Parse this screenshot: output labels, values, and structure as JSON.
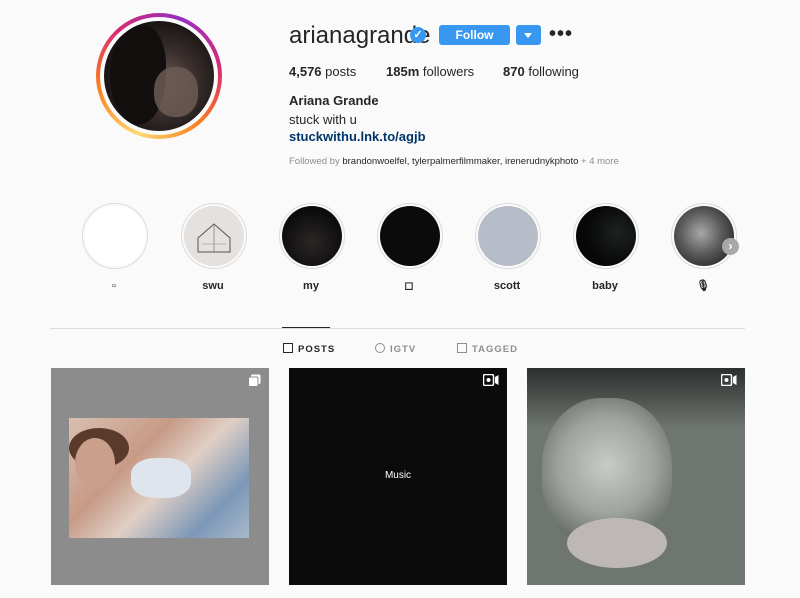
{
  "profile": {
    "username": "arianagrande",
    "verified_glyph": "✓",
    "follow_label": "Follow",
    "more_glyph": "•••",
    "stats": {
      "posts_count": "4,576",
      "posts_label": "posts",
      "followers_count": "185m",
      "followers_label": "followers",
      "following_count": "870",
      "following_label": "following"
    },
    "full_name": "Ariana Grande",
    "bio": "stuck with u",
    "link": "stuckwithu.lnk.to/agjb",
    "followed_by_prefix": "Followed by",
    "followed_by_names": "brandonwoelfel, tylerpalmerfilmmaker, irenerudnykphoto",
    "followed_by_suffix": "+ 4 more"
  },
  "highlights": [
    {
      "label": "▫"
    },
    {
      "label": "swu"
    },
    {
      "label": "my"
    },
    {
      "label": "◻"
    },
    {
      "label": "scott"
    },
    {
      "label": "baby"
    },
    {
      "label": "🎙"
    }
  ],
  "highlights_next_glyph": "›",
  "tabs": [
    {
      "label": "POSTS",
      "active": true,
      "icon": "grid-icon"
    },
    {
      "label": "IGTV",
      "active": false,
      "icon": "igtv-icon"
    },
    {
      "label": "TAGGED",
      "active": false,
      "icon": "tagged-icon"
    }
  ],
  "posts": [
    {
      "type": "carousel",
      "icon": "carousel-icon"
    },
    {
      "type": "video",
      "icon": "video-icon",
      "overlay_text": "Music",
      "brand_glyph": ""
    },
    {
      "type": "video",
      "icon": "video-icon"
    }
  ],
  "colors": {
    "accent": "#3897f0",
    "link": "#003569",
    "muted": "#8e8e8e"
  }
}
